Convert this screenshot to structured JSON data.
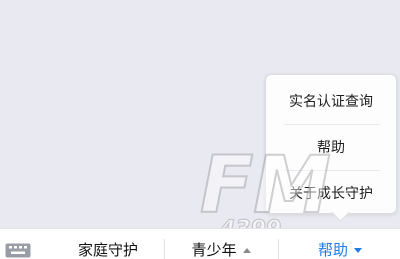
{
  "popup_menu": {
    "items": [
      "实名认证查询",
      "帮助",
      "关于成长守护"
    ]
  },
  "bottom_bar": {
    "keyboard_icon": "keyboard-icon",
    "family_label": "家庭守护",
    "youth_label": "青少年",
    "help_label": "帮助",
    "help_color": "#1f7de8"
  },
  "watermark": {
    "text": "FM",
    "subtext": "4399"
  }
}
